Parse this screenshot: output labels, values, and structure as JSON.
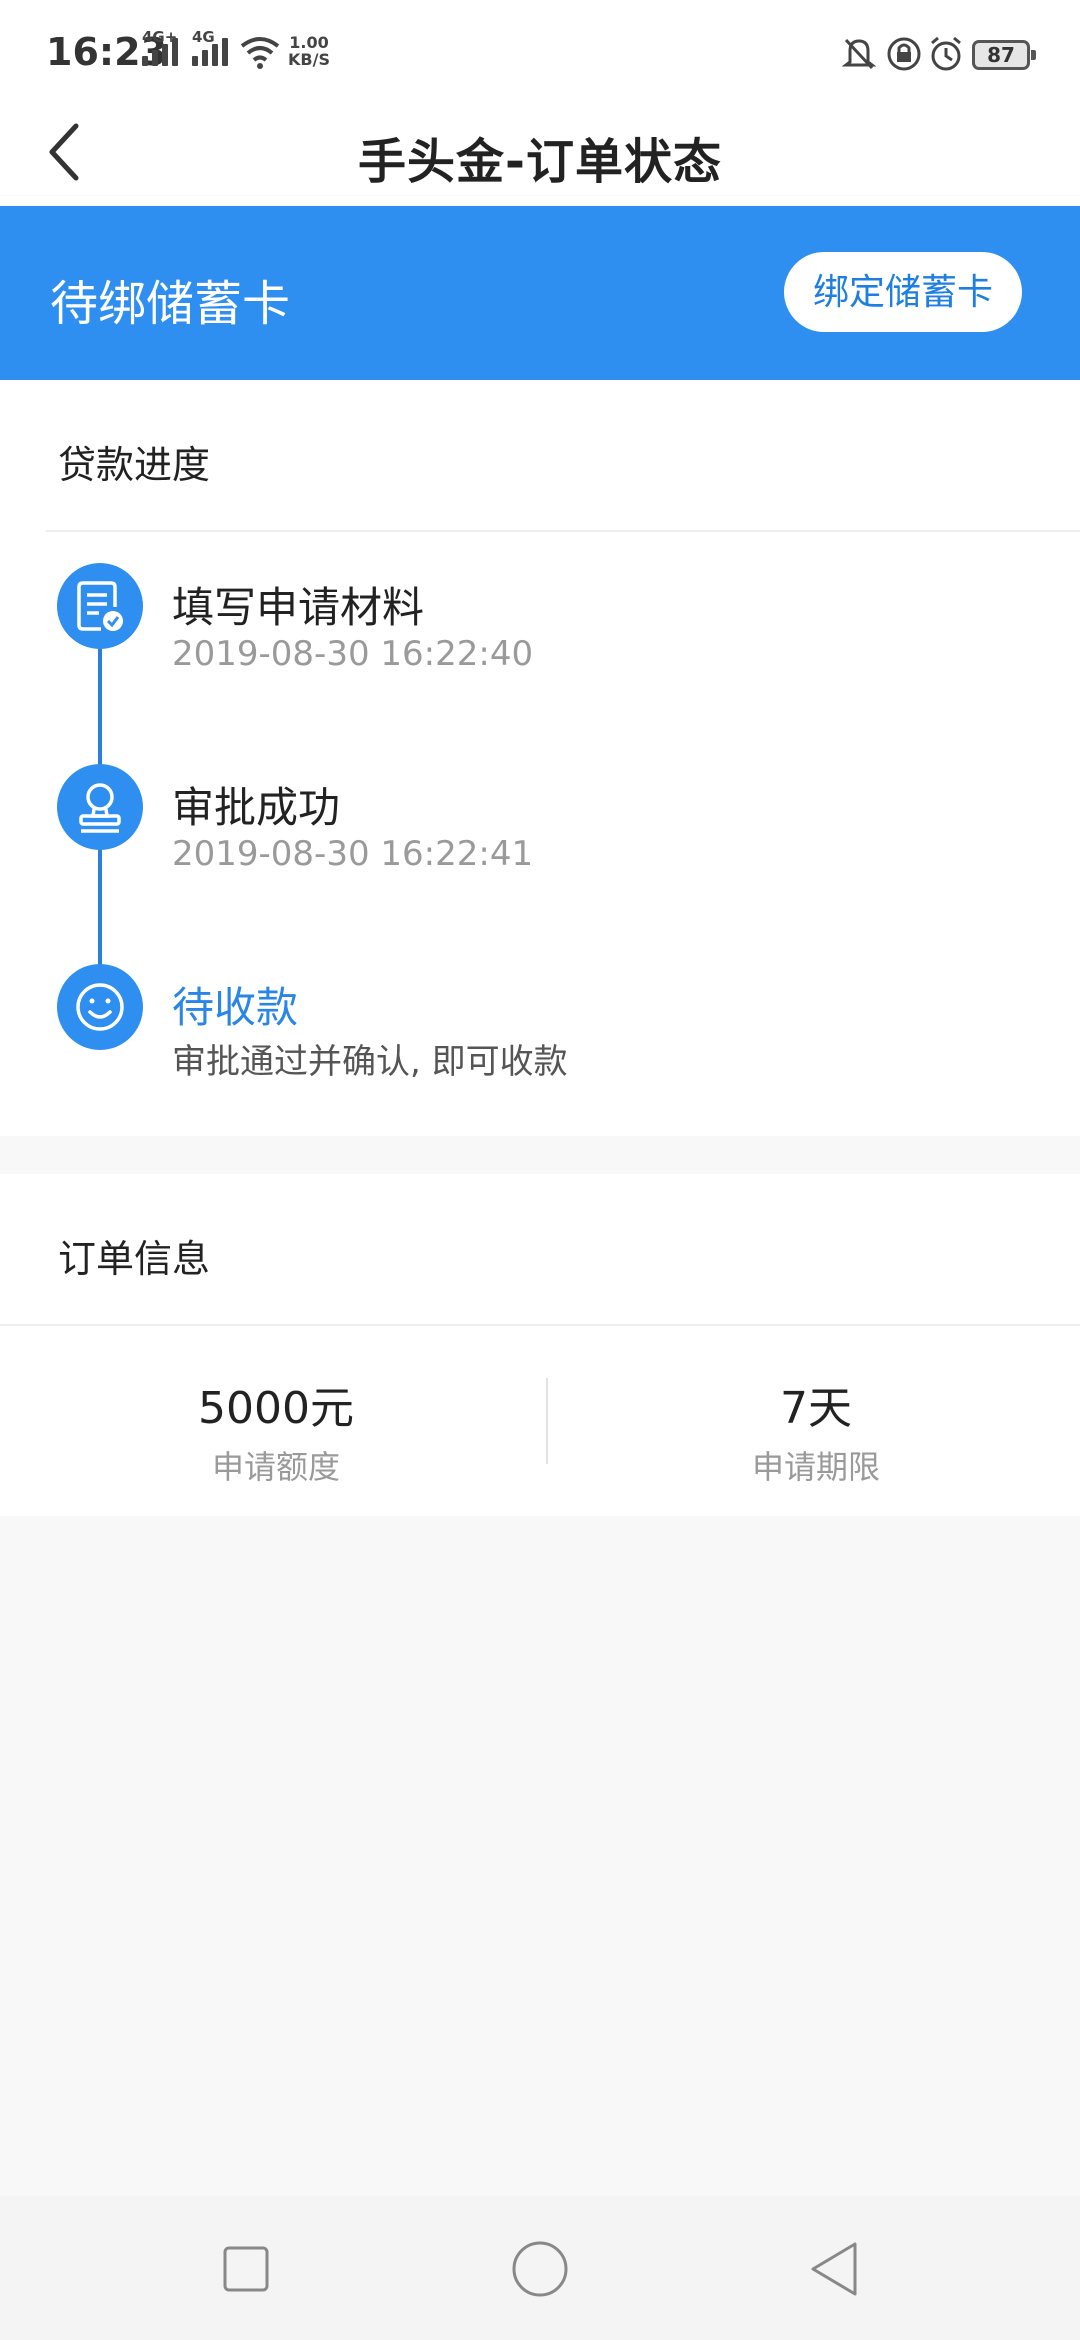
{
  "status_bar": {
    "time": "16:23",
    "net1": "4G+",
    "net2": "4G",
    "speed_value": "1.00",
    "speed_unit": "KB/S",
    "battery": "87"
  },
  "header": {
    "title": "手头金-订单状态",
    "back_icon": "chevron-left-icon"
  },
  "banner": {
    "status": "待绑储蓄卡",
    "button": "绑定储蓄卡",
    "color": "#2f8ff0"
  },
  "progress": {
    "title": "贷款进度",
    "steps": [
      {
        "title": "填写申请材料",
        "subtitle": "2019-08-30 16:22:40",
        "icon": "document-check-icon"
      },
      {
        "title": "审批成功",
        "subtitle": "2019-08-30 16:22:41",
        "icon": "stamp-icon"
      },
      {
        "title": "待收款",
        "subtitle": "审批通过并确认, 即可收款",
        "icon": "smile-icon"
      }
    ]
  },
  "order_info": {
    "title": "订单信息",
    "amount_value": "5000元",
    "amount_label": "申请额度",
    "term_value": "7天",
    "term_label": "申请期限"
  },
  "nav": {
    "recents_icon": "square-icon",
    "home_icon": "circle-icon",
    "back_icon": "triangle-back-icon"
  }
}
